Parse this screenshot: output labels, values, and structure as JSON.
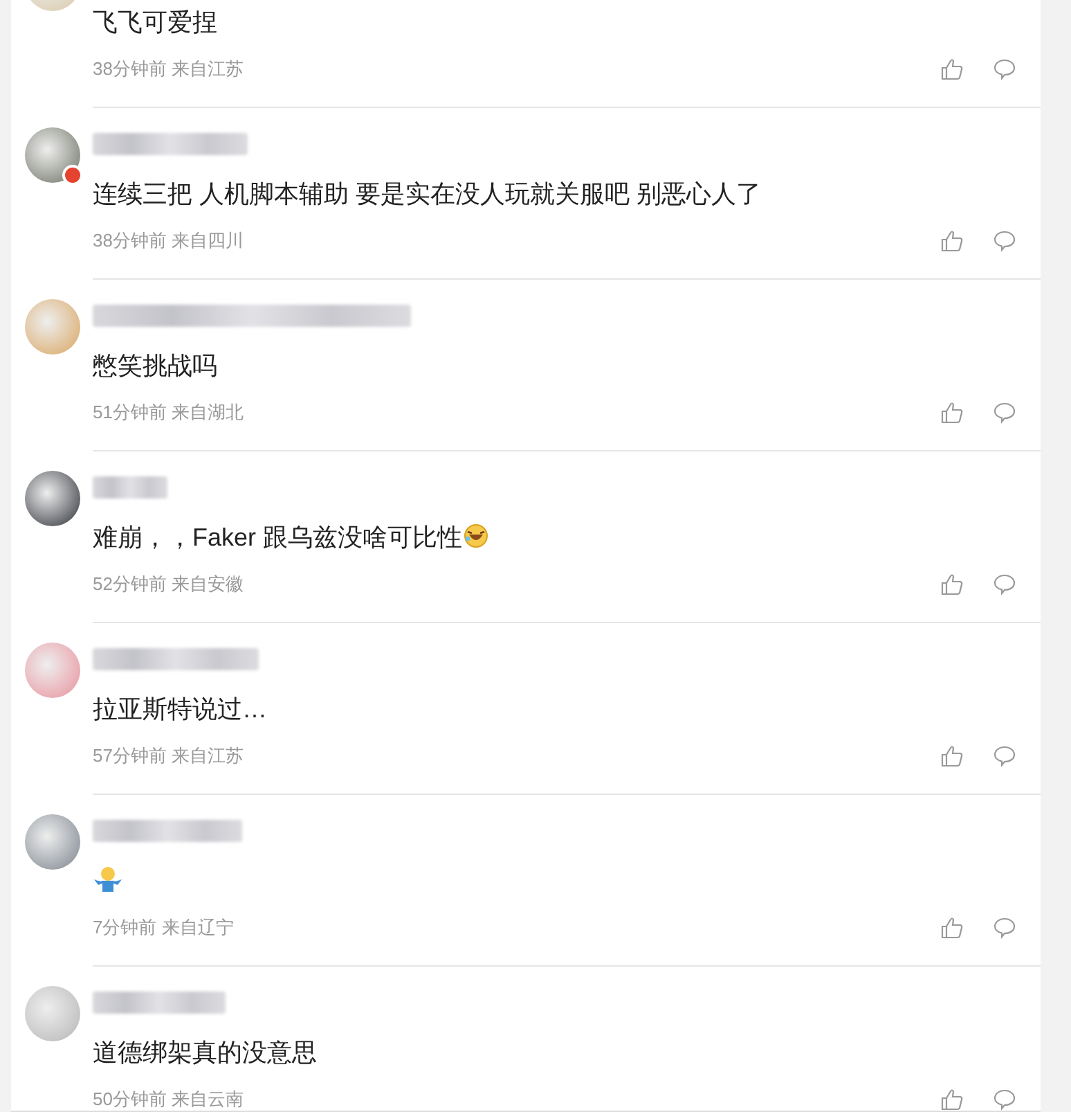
{
  "comments": [
    {
      "parts": [
        {
          "kind": "text",
          "text": "飞飞可爱捏"
        }
      ],
      "time": "38分钟前",
      "location": "来自江苏",
      "avatar_badge": false
    },
    {
      "parts": [
        {
          "kind": "text",
          "text": "连续三把 人机脚本辅助 要是实在没人玩就关服吧 别恶心人了"
        }
      ],
      "time": "38分钟前",
      "location": "来自四川",
      "avatar_badge": true
    },
    {
      "parts": [
        {
          "kind": "text",
          "text": "憋笑挑战吗"
        }
      ],
      "time": "51分钟前",
      "location": "来自湖北",
      "avatar_badge": false
    },
    {
      "parts": [
        {
          "kind": "text",
          "text": "难崩，，Faker 跟乌兹没啥可比性"
        },
        {
          "kind": "laugh"
        }
      ],
      "time": "52分钟前",
      "location": "来自安徽",
      "avatar_badge": false
    },
    {
      "parts": [
        {
          "kind": "text",
          "text": "拉亚斯特说过…"
        }
      ],
      "time": "57分钟前",
      "location": "来自江苏",
      "avatar_badge": false
    },
    {
      "parts": [
        {
          "kind": "shrug"
        }
      ],
      "time": "7分钟前",
      "location": "来自辽宁",
      "avatar_badge": false
    },
    {
      "parts": [
        {
          "kind": "text",
          "text": "道德绑架真的没意思"
        }
      ],
      "time": "50分钟前",
      "location": "来自云南",
      "avatar_badge": false
    }
  ]
}
